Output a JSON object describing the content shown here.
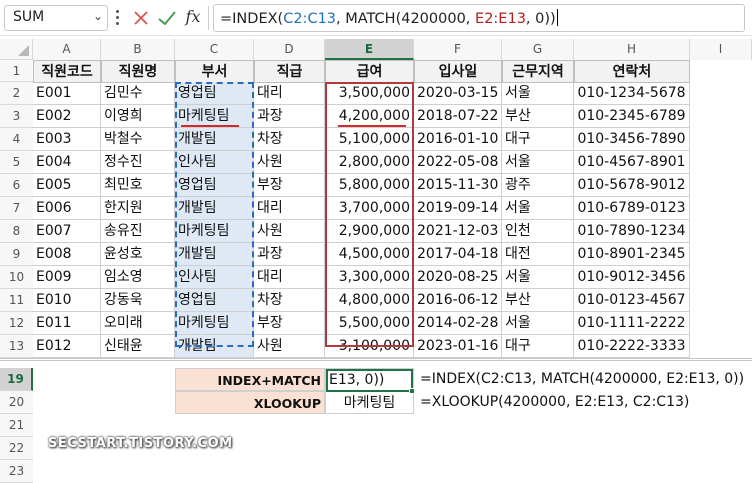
{
  "formula_bar": {
    "name_box": "SUM",
    "formula_pre": "=INDEX(",
    "formula_ref1": "C2:C13",
    "formula_mid": ", MATCH(4200000, ",
    "formula_ref2": "E2:E13",
    "formula_post": ", 0))",
    "cancel_icon": "cancel-x-icon",
    "enter_icon": "check-icon",
    "fx_label": "fx"
  },
  "columns": [
    "A",
    "B",
    "C",
    "D",
    "E",
    "F",
    "G",
    "H",
    "I"
  ],
  "selected_column": "E",
  "headers": [
    "직원코드",
    "직원명",
    "부서",
    "직급",
    "급여",
    "입사일",
    "근무지역",
    "연락처"
  ],
  "rows": [
    {
      "row": "2",
      "cells": [
        "E001",
        "김민수",
        "영업팀",
        "대리",
        "3,500,000",
        "2020-03-15",
        "서울",
        "010-1234-5678"
      ]
    },
    {
      "row": "3",
      "cells": [
        "E002",
        "이영희",
        "마케팅팀",
        "과장",
        "4,200,000",
        "2018-07-22",
        "부산",
        "010-2345-6789"
      ]
    },
    {
      "row": "4",
      "cells": [
        "E003",
        "박철수",
        "개발팀",
        "차장",
        "5,100,000",
        "2016-01-10",
        "대구",
        "010-3456-7890"
      ]
    },
    {
      "row": "5",
      "cells": [
        "E004",
        "정수진",
        "인사팀",
        "사원",
        "2,800,000",
        "2022-05-08",
        "서울",
        "010-4567-8901"
      ]
    },
    {
      "row": "6",
      "cells": [
        "E005",
        "최민호",
        "영업팀",
        "부장",
        "5,800,000",
        "2015-11-30",
        "광주",
        "010-5678-9012"
      ]
    },
    {
      "row": "7",
      "cells": [
        "E006",
        "한지원",
        "개발팀",
        "대리",
        "3,700,000",
        "2019-09-14",
        "서울",
        "010-6789-0123"
      ]
    },
    {
      "row": "8",
      "cells": [
        "E007",
        "송유진",
        "마케팅팀",
        "사원",
        "2,900,000",
        "2021-12-03",
        "인천",
        "010-7890-1234"
      ]
    },
    {
      "row": "9",
      "cells": [
        "E008",
        "윤성호",
        "개발팀",
        "과장",
        "4,500,000",
        "2017-04-18",
        "대전",
        "010-8901-2345"
      ]
    },
    {
      "row": "10",
      "cells": [
        "E009",
        "임소영",
        "인사팀",
        "대리",
        "3,300,000",
        "2020-08-25",
        "서울",
        "010-9012-3456"
      ]
    },
    {
      "row": "11",
      "cells": [
        "E010",
        "강동욱",
        "영업팀",
        "차장",
        "4,800,000",
        "2016-06-12",
        "부산",
        "010-0123-4567"
      ]
    },
    {
      "row": "12",
      "cells": [
        "E011",
        "오미래",
        "마케팅팀",
        "부장",
        "5,500,000",
        "2014-02-28",
        "서울",
        "010-1111-2222"
      ]
    },
    {
      "row": "13",
      "cells": [
        "E012",
        "신태윤",
        "개발팀",
        "사원",
        "3,100,000",
        "2023-01-16",
        "대구",
        "010-2222-3333"
      ]
    }
  ],
  "lower_rows": [
    "19",
    "20",
    "21",
    "22",
    "23"
  ],
  "selected_row": "19",
  "lookup": {
    "label1": "INDEX+MATCH",
    "value1": "E13, 0))",
    "note1": "=INDEX(C2:C13, MATCH(4200000, E2:E13, 0))",
    "label2": "XLOOKUP",
    "value2": "마케팅팀",
    "note2": "=XLOOKUP(4200000, E2:E13, C2:C13)"
  },
  "watermark": "SECSTART.TISTORY.COM"
}
